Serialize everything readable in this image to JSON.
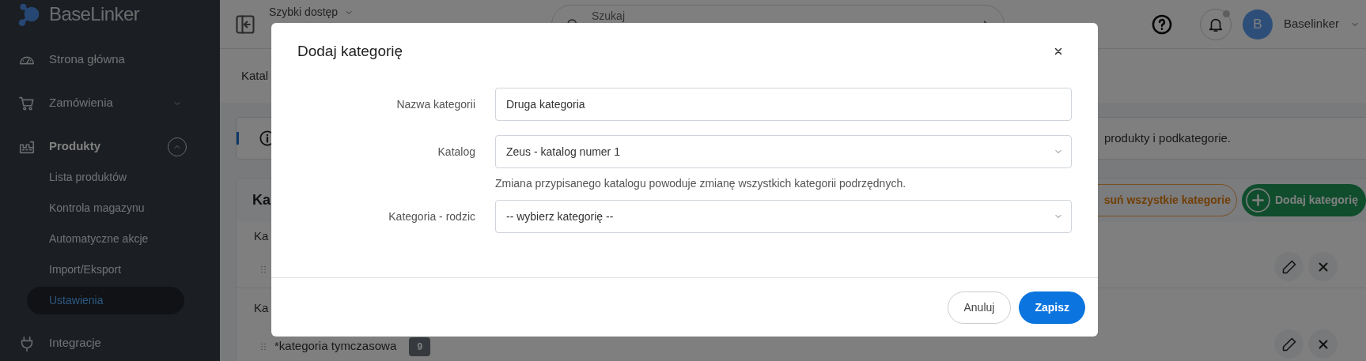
{
  "sidebar": {
    "logo": "BaseLinker",
    "items": [
      {
        "label": "Strona główna",
        "kind": "link"
      },
      {
        "label": "Zamówienia",
        "kind": "group",
        "expanded": false
      },
      {
        "label": "Produkty",
        "kind": "group",
        "expanded": true,
        "children": [
          {
            "label": "Lista produktów",
            "selected": false
          },
          {
            "label": "Kontrola magazynu",
            "selected": false
          },
          {
            "label": "Automatyczne akcje",
            "selected": false
          },
          {
            "label": "Import/Eksport",
            "selected": false
          },
          {
            "label": "Ustawienia",
            "selected": true
          }
        ]
      },
      {
        "label": "Integracje",
        "kind": "link"
      }
    ]
  },
  "top_bar": {
    "quick_access": "Szybki dostęp",
    "search": {
      "placeholder": "Szukaj"
    },
    "avatar": "B",
    "user": "Baselinker"
  },
  "page_tab": "Katal",
  "info_banner": "produkty i podkategorie.",
  "card": {
    "title": "Ka",
    "buttons": [
      {
        "label": "suń wszystkie kategorie",
        "kind": "outline"
      },
      {
        "label": "Dodaj kategorię",
        "kind": "add"
      }
    ],
    "sections": [
      {
        "heading": "Ka",
        "rows": [
          {}
        ]
      },
      {
        "heading": "Ka",
        "rows": [
          {
            "name": "*kategoria tymczasowa",
            "count": "9"
          }
        ]
      }
    ]
  },
  "modal": {
    "title": "Dodaj kategorię",
    "fields": [
      {
        "label": "Nazwa kategorii",
        "kind": "text",
        "value": "Druga kategoria"
      },
      {
        "label": "Katalog",
        "kind": "select",
        "value": "Zeus - katalog numer 1",
        "hint": "Zmiana przypisanego katalogu powoduje zmianę wszystkich kategorii podrzędnych."
      },
      {
        "label": "Kategoria - rodzic",
        "kind": "select",
        "value": "-- wybierz kategorię --"
      }
    ],
    "buttons": [
      {
        "label": "Anuluj",
        "kind": "secondary"
      },
      {
        "label": "Zapisz",
        "kind": "primary"
      }
    ]
  }
}
